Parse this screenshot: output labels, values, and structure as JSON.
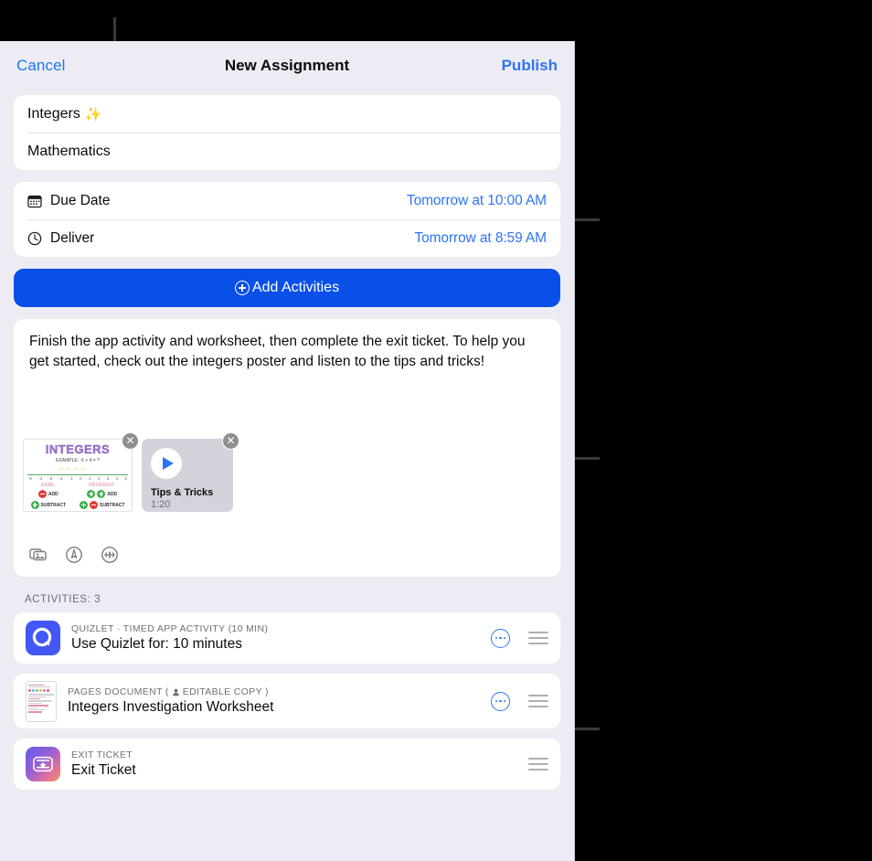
{
  "nav": {
    "cancel_label": "Cancel",
    "title": "New Assignment",
    "publish_label": "Publish"
  },
  "details": {
    "assignment_title": "Integers",
    "assignment_title_emoji": "✨",
    "subject": "Mathematics"
  },
  "schedule": {
    "due_date_label": "Due Date",
    "due_date_value": "Tomorrow at 10:00 AM",
    "deliver_label": "Deliver",
    "deliver_value": "Tomorrow at 8:59 AM"
  },
  "actions": {
    "add_activities_label": "Add Activities"
  },
  "instructions": {
    "text": "Finish the app activity and worksheet, then complete the exit ticket. To help you get started, check out the integers poster and listen to the tips and tricks!",
    "attachments": [
      {
        "kind": "image",
        "name": "Integers poster",
        "poster_title": "INTEGERS",
        "poster_example": "EXAMPLE: -5 + 4 = ?",
        "poster_axis": [
          "-5",
          "-4",
          "-3",
          "-2",
          "-1",
          "0",
          "1",
          "2",
          "3",
          "4",
          "5"
        ],
        "poster_col_left": "SAME",
        "poster_col_right": "DIFFERENT",
        "poster_rows": [
          {
            "left_sign": "-",
            "left_op": "ADD",
            "right_sign_a": "+",
            "right_sign_b": "+",
            "right_op": "ADD"
          },
          {
            "left_sign": "+",
            "left_op": "SUBTRACT",
            "right_sign_a": "+",
            "right_sign_b": "-",
            "right_op": "SUBTRACT"
          }
        ],
        "close_label": "✕"
      },
      {
        "kind": "video",
        "title": "Tips & Tricks",
        "duration": "1:20",
        "close_label": "✕"
      }
    ],
    "toolbar_icons": [
      "photo-library-icon",
      "markup-pen-icon",
      "audio-recording-icon"
    ]
  },
  "activities_section": {
    "header": "ACTIVITIES: 3",
    "items": [
      {
        "icon": "quizlet-app-icon",
        "kicker": "QUIZLET · TIMED APP ACTIVITY (10 MIN)",
        "title": "Use Quizlet for: 10 minutes",
        "has_more_button": true,
        "has_drag_handle": true
      },
      {
        "icon": "pages-document-icon",
        "kicker_prefix": "PAGES DOCUMENT",
        "kicker_badge": "EDITABLE COPY",
        "kicker": "PAGES DOCUMENT  (👤 EDITABLE COPY)",
        "title": "Integers Investigation Worksheet",
        "has_more_button": true,
        "has_drag_handle": true
      },
      {
        "icon": "exit-ticket-icon",
        "kicker": "EXIT TICKET",
        "title": "Exit Ticket",
        "has_more_button": false,
        "has_drag_handle": true
      }
    ]
  },
  "colors": {
    "accent_blue": "#2F74F5",
    "button_blue": "#0A50E8",
    "panel_bg": "#EDECF4",
    "card_bg": "#FFFFFF",
    "secondary_text": "#6E6E78",
    "quizlet_purple": "#4257F5"
  }
}
